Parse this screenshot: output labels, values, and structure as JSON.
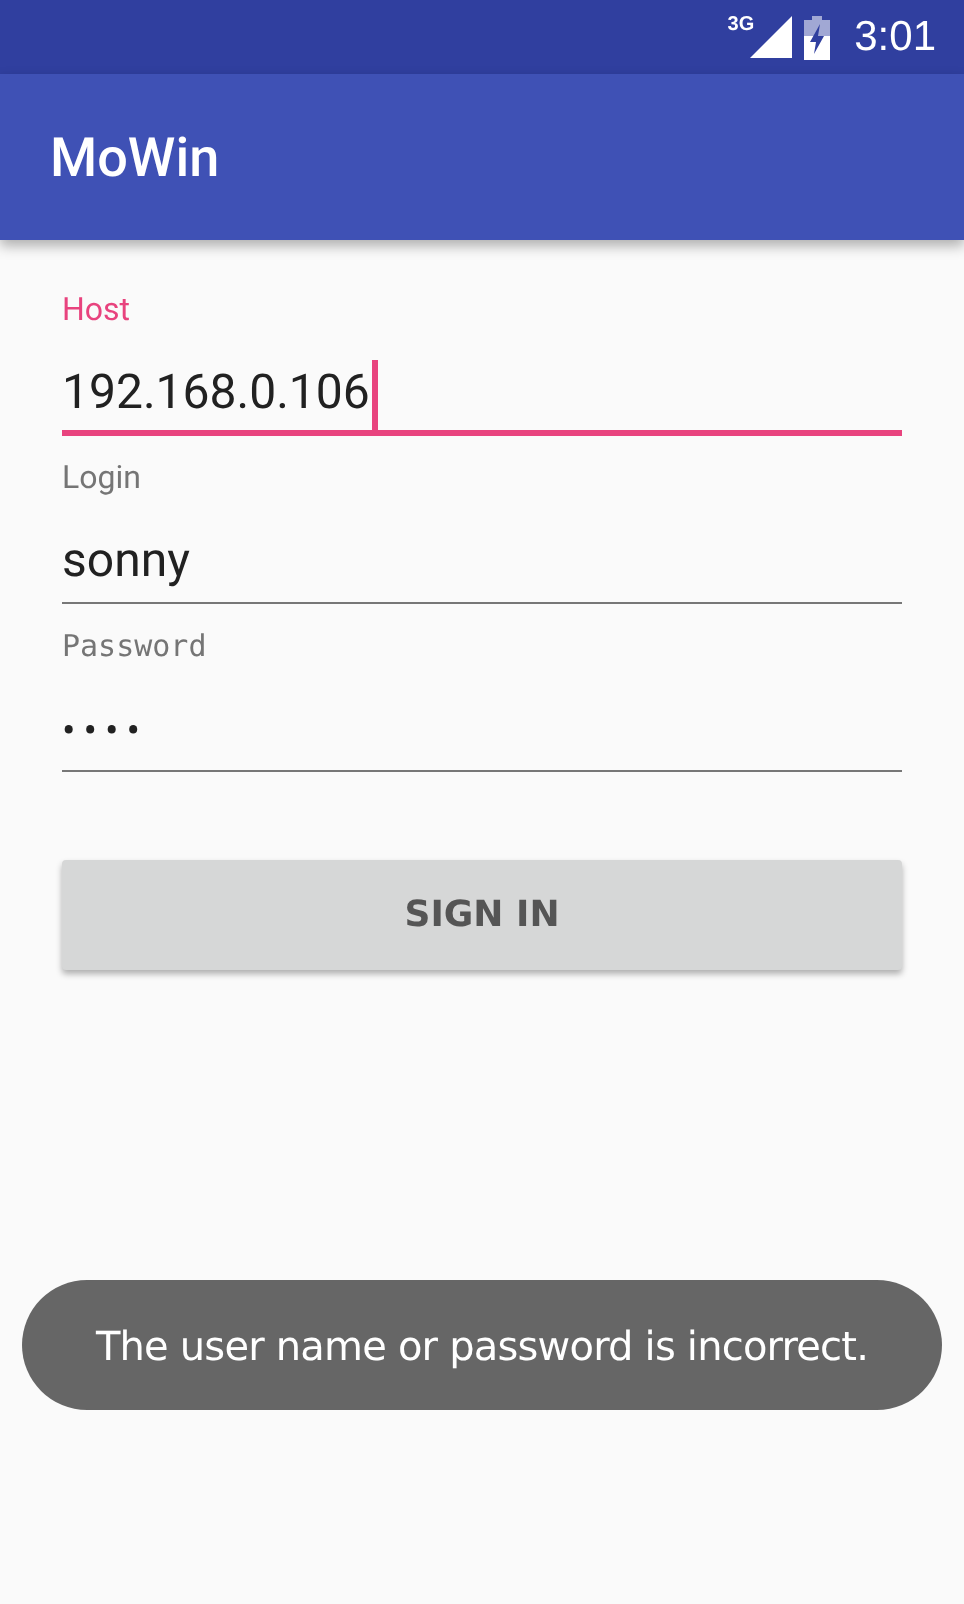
{
  "status_bar": {
    "network": "3G",
    "time": "3:01"
  },
  "app_bar": {
    "title": "MoWin"
  },
  "fields": [
    {
      "kind": "text",
      "label": "Host",
      "value": "192.168.0.106",
      "focused": true
    },
    {
      "kind": "text",
      "label": "Login",
      "value": "sonny",
      "focused": false
    },
    {
      "kind": "password",
      "label": "Password",
      "value": "••••",
      "focused": false
    }
  ],
  "button": {
    "label": "SIGN IN"
  },
  "toast": {
    "text": "The user name or password is incorrect."
  }
}
